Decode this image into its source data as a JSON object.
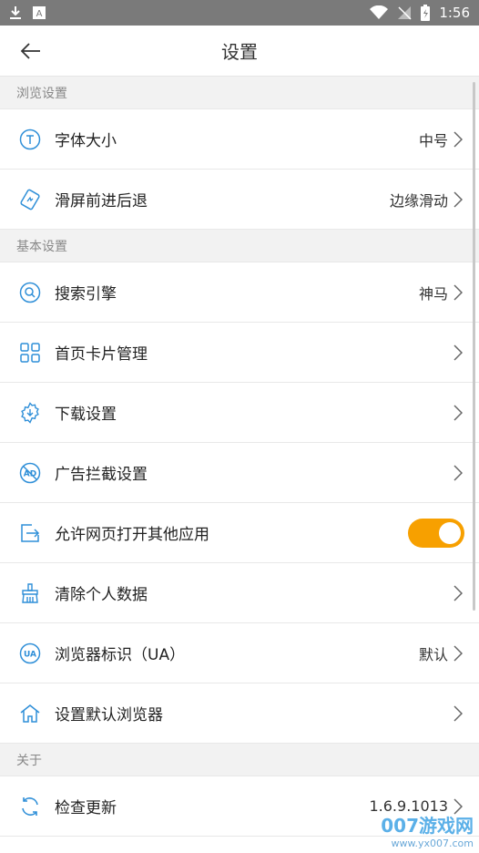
{
  "status_bar": {
    "time": "1:56"
  },
  "header": {
    "title": "设置"
  },
  "sections": [
    {
      "title": "浏览设置",
      "items": [
        {
          "label": "字体大小",
          "value": "中号",
          "icon": "font-size-icon"
        },
        {
          "label": "滑屏前进后退",
          "value": "边缘滑动",
          "icon": "swipe-icon"
        }
      ]
    },
    {
      "title": "基本设置",
      "items": [
        {
          "label": "搜索引擎",
          "value": "神马",
          "icon": "search-icon"
        },
        {
          "label": "首页卡片管理",
          "value": "",
          "icon": "grid-icon"
        },
        {
          "label": "下载设置",
          "value": "",
          "icon": "download-icon"
        },
        {
          "label": "广告拦截设置",
          "value": "",
          "icon": "ad-block-icon"
        },
        {
          "label": "允许网页打开其他应用",
          "value": "",
          "icon": "open-external-icon",
          "toggle": true
        },
        {
          "label": "清除个人数据",
          "value": "",
          "icon": "brush-icon"
        },
        {
          "label": "浏览器标识（UA）",
          "value": "默认",
          "icon": "ua-icon"
        },
        {
          "label": "设置默认浏览器",
          "value": "",
          "icon": "home-icon"
        }
      ]
    },
    {
      "title": "关于",
      "items": [
        {
          "label": "检查更新",
          "value": "1.6.9.1013",
          "icon": "refresh-icon"
        }
      ]
    }
  ],
  "watermark": {
    "main": "007游戏网",
    "url": "www.yx007.com"
  },
  "colors": {
    "accent": "#2f8fd8",
    "toggle_on": "#f7a000",
    "status_bar": "#7a7a7a"
  }
}
